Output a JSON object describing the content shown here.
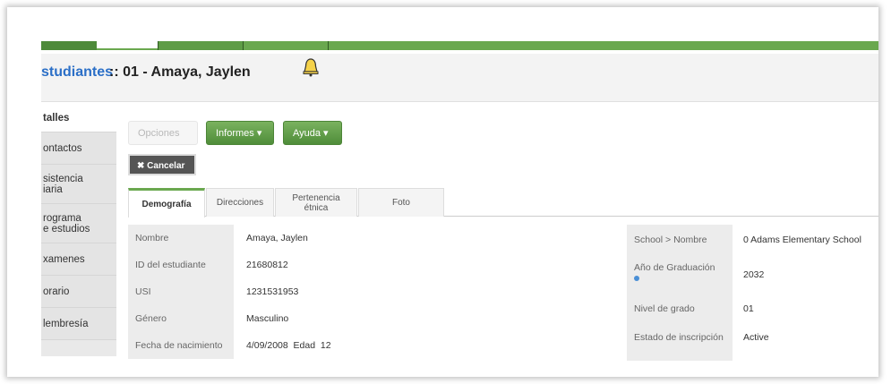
{
  "header": {
    "title_link": "studiantes",
    "title_rest": ":: 01 - Amaya, Jaylen"
  },
  "sidebar": {
    "items": [
      {
        "label": "talles"
      },
      {
        "label": "ontactos"
      },
      {
        "label": "sistencia\niaria"
      },
      {
        "label": "rograma\ne estudios"
      },
      {
        "label": "xamenes"
      },
      {
        "label": "orario"
      },
      {
        "label": "lembresía"
      }
    ]
  },
  "toolbar": {
    "opciones_label": "Opciones",
    "informes_label": "Informes ▾",
    "ayuda_label": "Ayuda ▾",
    "cancel_label": "✖ Cancelar"
  },
  "tabs": [
    {
      "label": "Demografía"
    },
    {
      "label": "Direcciones"
    },
    {
      "label": "Pertenencia\nétnica"
    },
    {
      "label": "Foto"
    }
  ],
  "fields_left": [
    {
      "label": "Nombre",
      "value": "Amaya, Jaylen"
    },
    {
      "label": "ID del estudiante",
      "value": "21680812"
    },
    {
      "label": "USI",
      "value": "1231531953"
    },
    {
      "label": "Género",
      "value": "Masculino"
    },
    {
      "label": "Fecha de nacimiento",
      "value": "4/09/2008  Edad  12"
    }
  ],
  "fields_right": [
    {
      "label": "School > Nombre",
      "value": "0 Adams Elementary School"
    },
    {
      "label": "Año de Graduación",
      "value": "2032"
    },
    {
      "label": "Nivel de grado",
      "value": "01"
    },
    {
      "label": "Estado de inscripción",
      "value": "Active"
    }
  ],
  "colors": {
    "accent_green": "#6aa84f",
    "link_blue": "#2b6fc7"
  }
}
